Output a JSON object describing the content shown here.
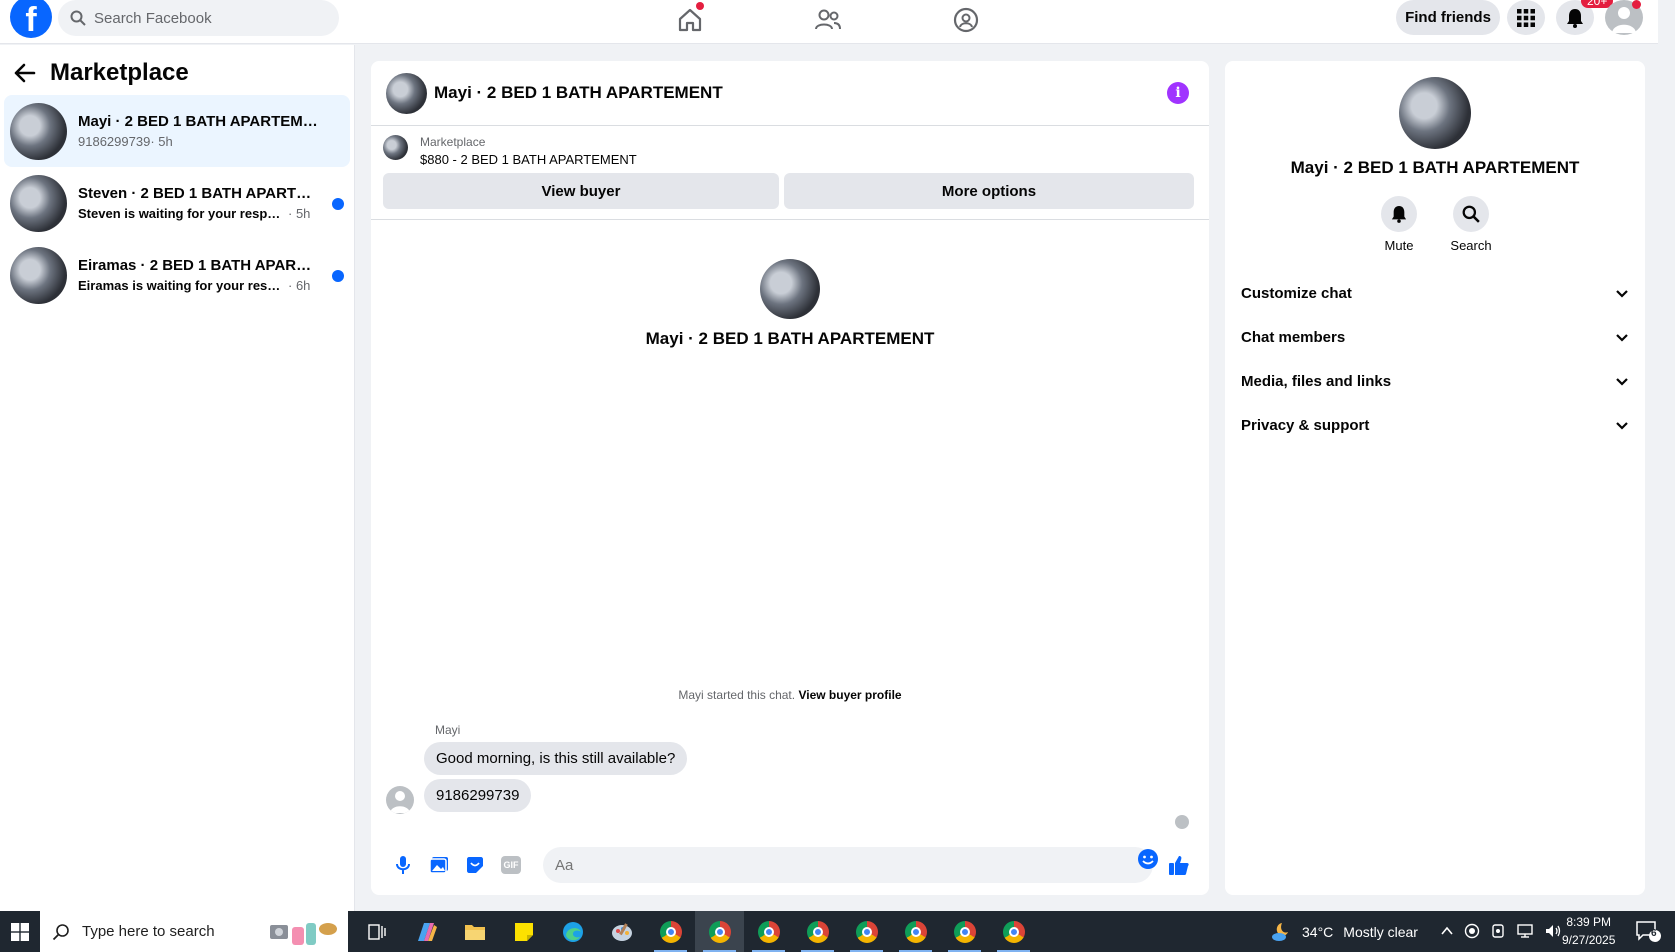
{
  "header": {
    "search_placeholder": "Search Facebook",
    "find_friends_label": "Find friends",
    "notification_count": "20+"
  },
  "sidebar": {
    "title": "Marketplace",
    "conversations": [
      {
        "name": "Mayi · 2 BED 1 BATH APARTEMENT",
        "snippet": "9186299739",
        "time": " · 5h",
        "unread": false,
        "active": true
      },
      {
        "name": "Steven · 2 BED 1 BATH APARTEMENT",
        "snippet": "Steven is waiting for your response.",
        "time": " · 5h",
        "unread": true,
        "active": false
      },
      {
        "name": "Eiramas · 2 BED 1 BATH APARTEMENT",
        "snippet": "Eiramas is waiting for your response",
        "time": " · 6h",
        "unread": true,
        "active": false
      }
    ]
  },
  "chat": {
    "title": "Mayi · 2 BED 1 BATH APARTEMENT",
    "listing": {
      "category": "Marketplace",
      "price_title": "$880 - 2 BED 1 BATH APARTEMENT",
      "view_buyer_label": "View buyer",
      "more_options_label": "More options"
    },
    "intro_name": "Mayi · 2 BED 1 BATH APARTEMENT",
    "started_text": "Mayi started this chat.",
    "view_profile_link": "View buyer profile",
    "sender": "Mayi",
    "messages": [
      "Good morning, is this still available?",
      "9186299739"
    ],
    "composer_placeholder": "Aa",
    "gif_label": "GIF"
  },
  "details": {
    "name": "Mayi · 2 BED 1 BATH APARTEMENT",
    "mute_label": "Mute",
    "search_label": "Search",
    "sections": [
      "Customize chat",
      "Chat members",
      "Media, files and links",
      "Privacy & support"
    ]
  },
  "taskbar": {
    "search_placeholder": "Type here to search",
    "weather_temp": "34°C",
    "weather_desc": "Mostly clear",
    "time": "8:39 PM",
    "date": "9/27/2025",
    "notification_count": "6"
  },
  "colors": {
    "brand": "#0866ff",
    "unread_dot": "#0866ff",
    "badge": "#e41e3f",
    "info": "#a033ff",
    "active_row": "#ebf5ff"
  }
}
